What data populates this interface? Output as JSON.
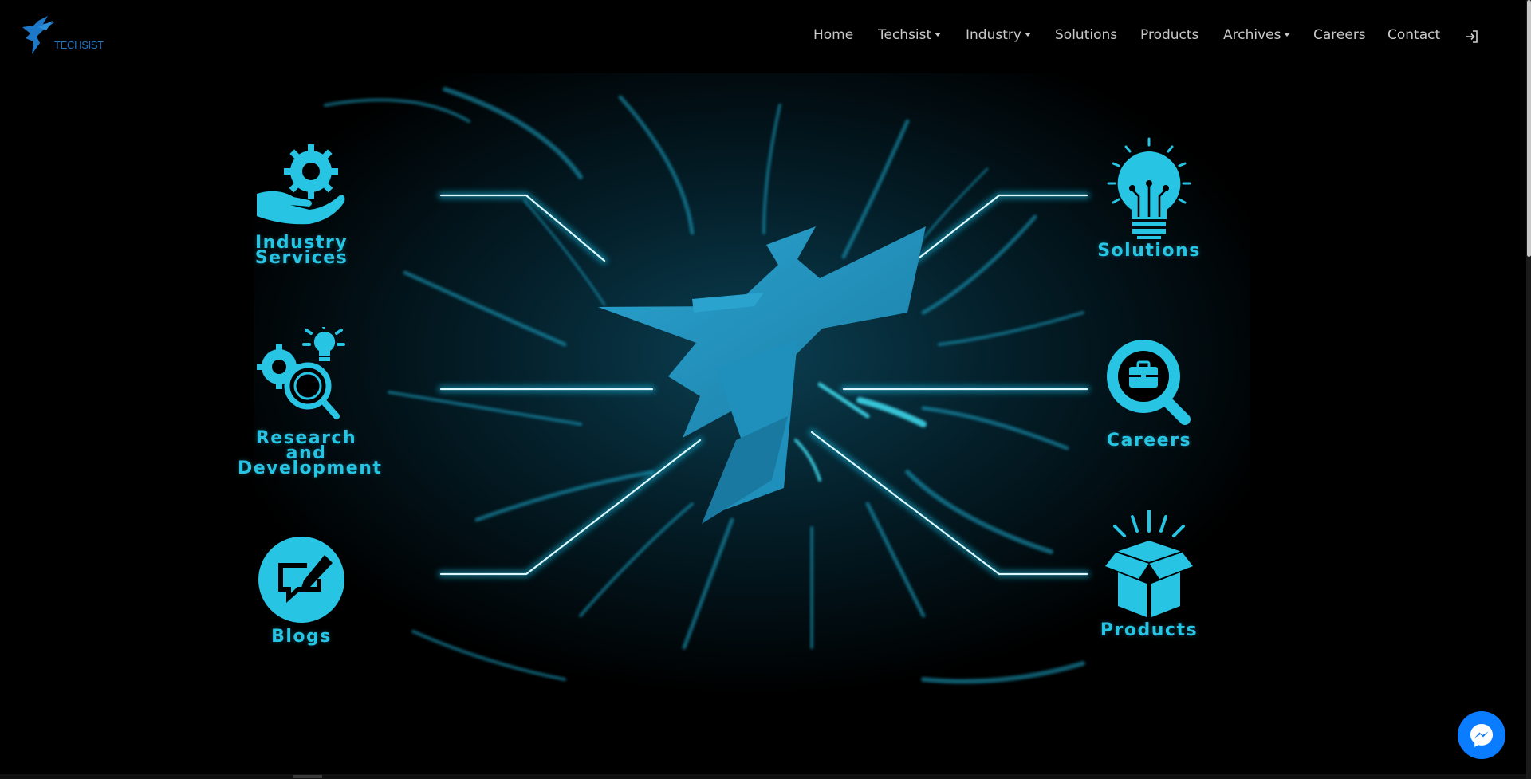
{
  "brand": {
    "name": "TECHSIST"
  },
  "nav": {
    "items": [
      {
        "label": "Home",
        "dropdown": false
      },
      {
        "label": "Techsist",
        "dropdown": true
      },
      {
        "label": "Industry",
        "dropdown": true
      },
      {
        "label": "Solutions",
        "dropdown": false
      },
      {
        "label": "Products",
        "dropdown": false
      },
      {
        "label": "Archives",
        "dropdown": true
      },
      {
        "label": "Careers",
        "dropdown": false
      },
      {
        "label": "Contact",
        "dropdown": false
      }
    ],
    "login_icon": "sign-in-icon"
  },
  "hero": {
    "tiles": [
      {
        "id": "industry-services",
        "label_line1": "Industry",
        "label_line2": "Services",
        "icon": "hand-gear-icon"
      },
      {
        "id": "research",
        "label_line1": "Research and",
        "label_line2": "Development",
        "icon": "gear-magnifier-bulb-icon"
      },
      {
        "id": "blogs",
        "label_line1": "Blogs",
        "label_line2": "",
        "icon": "edit-chat-icon"
      },
      {
        "id": "solutions",
        "label_line1": "Solutions",
        "label_line2": "",
        "icon": "lightbulb-circuit-icon"
      },
      {
        "id": "careers",
        "label_line1": "Careers",
        "label_line2": "",
        "icon": "briefcase-search-icon"
      },
      {
        "id": "products",
        "label_line1": "Products",
        "label_line2": "",
        "icon": "open-box-icon"
      }
    ],
    "center_icon": "techsist-emblem-icon"
  },
  "colors": {
    "accent": "#27c4e4",
    "logo": "#1e78c8",
    "messenger": "#0a7cff",
    "background": "#000000"
  },
  "chat": {
    "icon": "messenger-icon"
  }
}
